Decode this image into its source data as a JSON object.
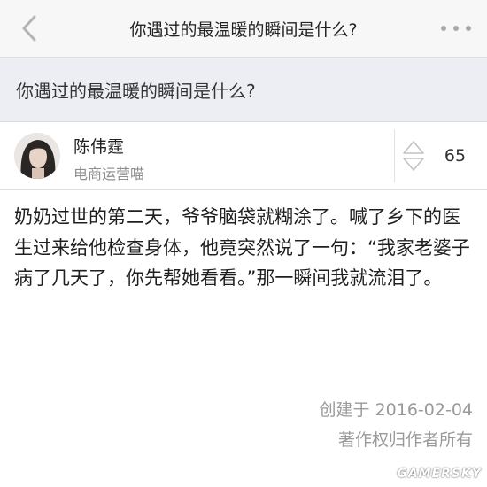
{
  "navbar": {
    "back_icon": "chevron-left-icon",
    "title": "你遇过的最温暖的瞬间是什么?",
    "more_icon": "more-dots-icon"
  },
  "question": {
    "title": "你遇过的最温暖的瞬间是什么?"
  },
  "author": {
    "name": "陈伟霆",
    "bio": "电商运营喵",
    "vote_icon": "updown-vote-icon",
    "votes": "65"
  },
  "answer": {
    "body": "奶奶过世的第二天，爷爷脑袋就糊涂了。喊了乡下的医生过来给他检查身体，他竟突然说了一句：“我家老婆子病了几天了，你先帮她看看。”那一瞬间我就流泪了。"
  },
  "footer": {
    "created": "创建于 2016-02-04",
    "copyright": "著作权归作者所有"
  },
  "watermark": "GAMERSKY",
  "colors": {
    "navbar_bg": "#f7f7f7",
    "question_bar_bg": "#eceef3",
    "secondary_text": "#8f8f8f",
    "icon_gray": "#a9a9a9"
  }
}
